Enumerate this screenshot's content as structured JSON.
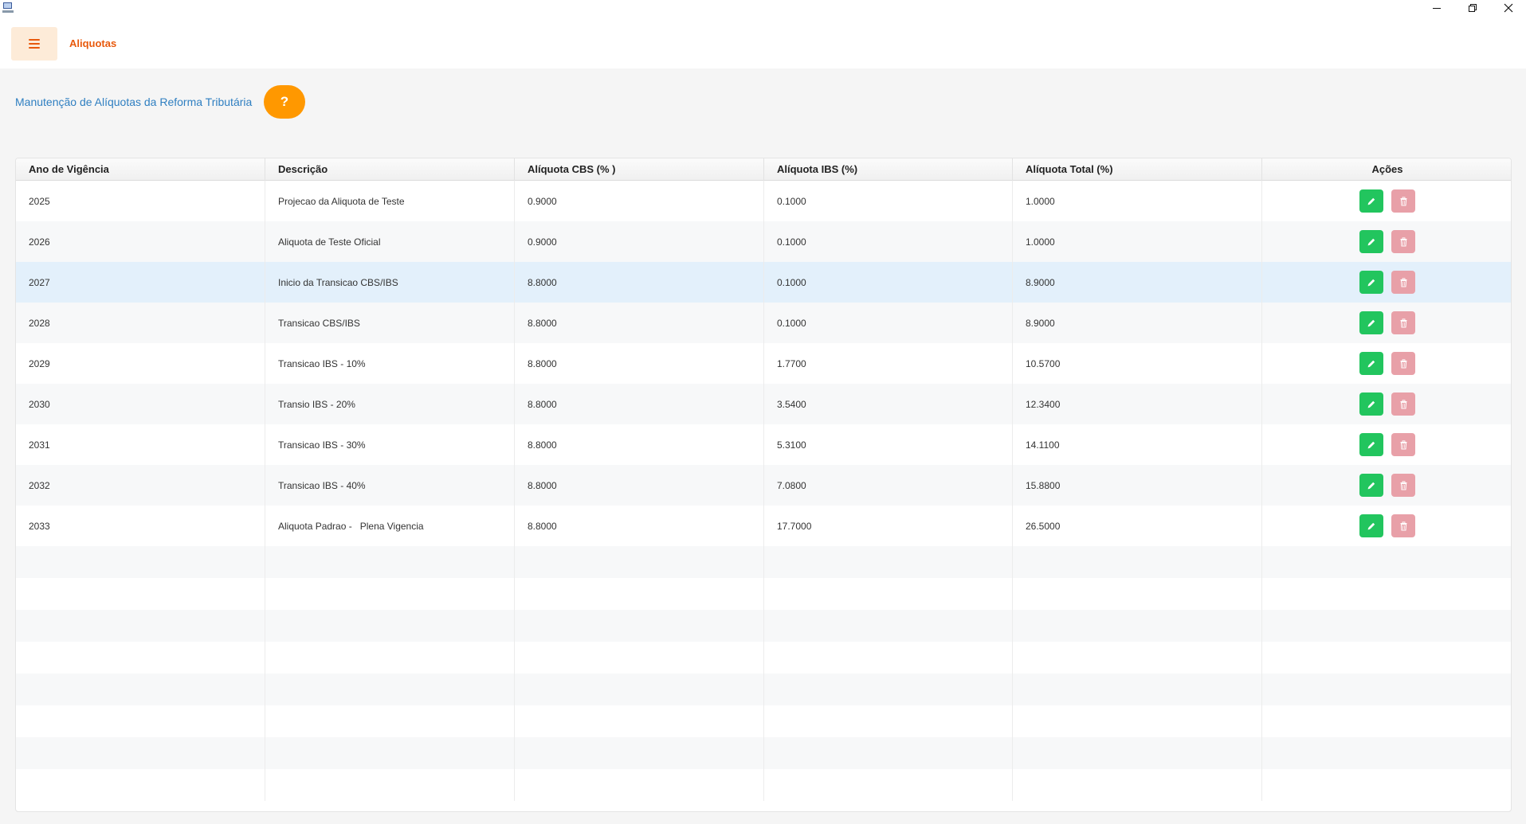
{
  "window": {
    "icon": "app-computer-icon",
    "controls": {
      "minimize": "minimize-icon",
      "maximize": "restore-icon",
      "close": "close-icon"
    },
    "close_glyph": "✕"
  },
  "header": {
    "menu_icon": "hamburger-menu-icon",
    "page_name": "Aliquotas"
  },
  "page": {
    "subtitle": "Manutenção de Alíquotas da Reforma Tributária",
    "help_label": "?"
  },
  "colors": {
    "accent": "#e8590c",
    "help": "#ff9800",
    "edit": "#22c55e",
    "delete_disabled": "#e8a0a8",
    "link": "#2f7fc1",
    "selected_row": "#e3f0fb"
  },
  "table": {
    "columns": [
      "Ano de Vigência",
      "Descrição",
      "Alíquota CBS (%  )",
      "Alíquota IBS (%)",
      "Alíquota Total (%)",
      "Ações"
    ],
    "rows": [
      {
        "ano": "2025",
        "descricao": "Projecao da Aliquota de Teste",
        "cbs": "0.9000",
        "ibs": "0.1000",
        "total": "1.0000"
      },
      {
        "ano": "2026",
        "descricao": "Aliquota de Teste Oficial",
        "cbs": "0.9000",
        "ibs": "0.1000",
        "total": "1.0000"
      },
      {
        "ano": "2027",
        "descricao": "Inicio da Transicao CBS/IBS",
        "cbs": "8.8000",
        "ibs": "0.1000",
        "total": "8.9000",
        "selected": true
      },
      {
        "ano": "2028",
        "descricao": "Transicao CBS/IBS",
        "cbs": "8.8000",
        "ibs": "0.1000",
        "total": "8.9000"
      },
      {
        "ano": "2029",
        "descricao": "Transicao IBS - 10%",
        "cbs": "8.8000",
        "ibs": "1.7700",
        "total": "10.5700"
      },
      {
        "ano": "2030",
        "descricao": "Transio IBS - 20%",
        "cbs": "8.8000",
        "ibs": "3.5400",
        "total": "12.3400"
      },
      {
        "ano": "2031",
        "descricao": "Transicao IBS - 30%",
        "cbs": "8.8000",
        "ibs": "5.3100",
        "total": "14.1100"
      },
      {
        "ano": "2032",
        "descricao": "Transicao IBS - 40%",
        "cbs": "8.8000",
        "ibs": "7.0800",
        "total": "15.8800"
      },
      {
        "ano": "2033",
        "descricao": "Aliquota Padrao -   Plena Vigencia",
        "cbs": "8.8000",
        "ibs": "17.7000",
        "total": "26.5000"
      }
    ],
    "row_actions": {
      "edit_icon": "pencil-icon",
      "delete_icon": "trash-icon"
    },
    "empty_rows": 8
  }
}
